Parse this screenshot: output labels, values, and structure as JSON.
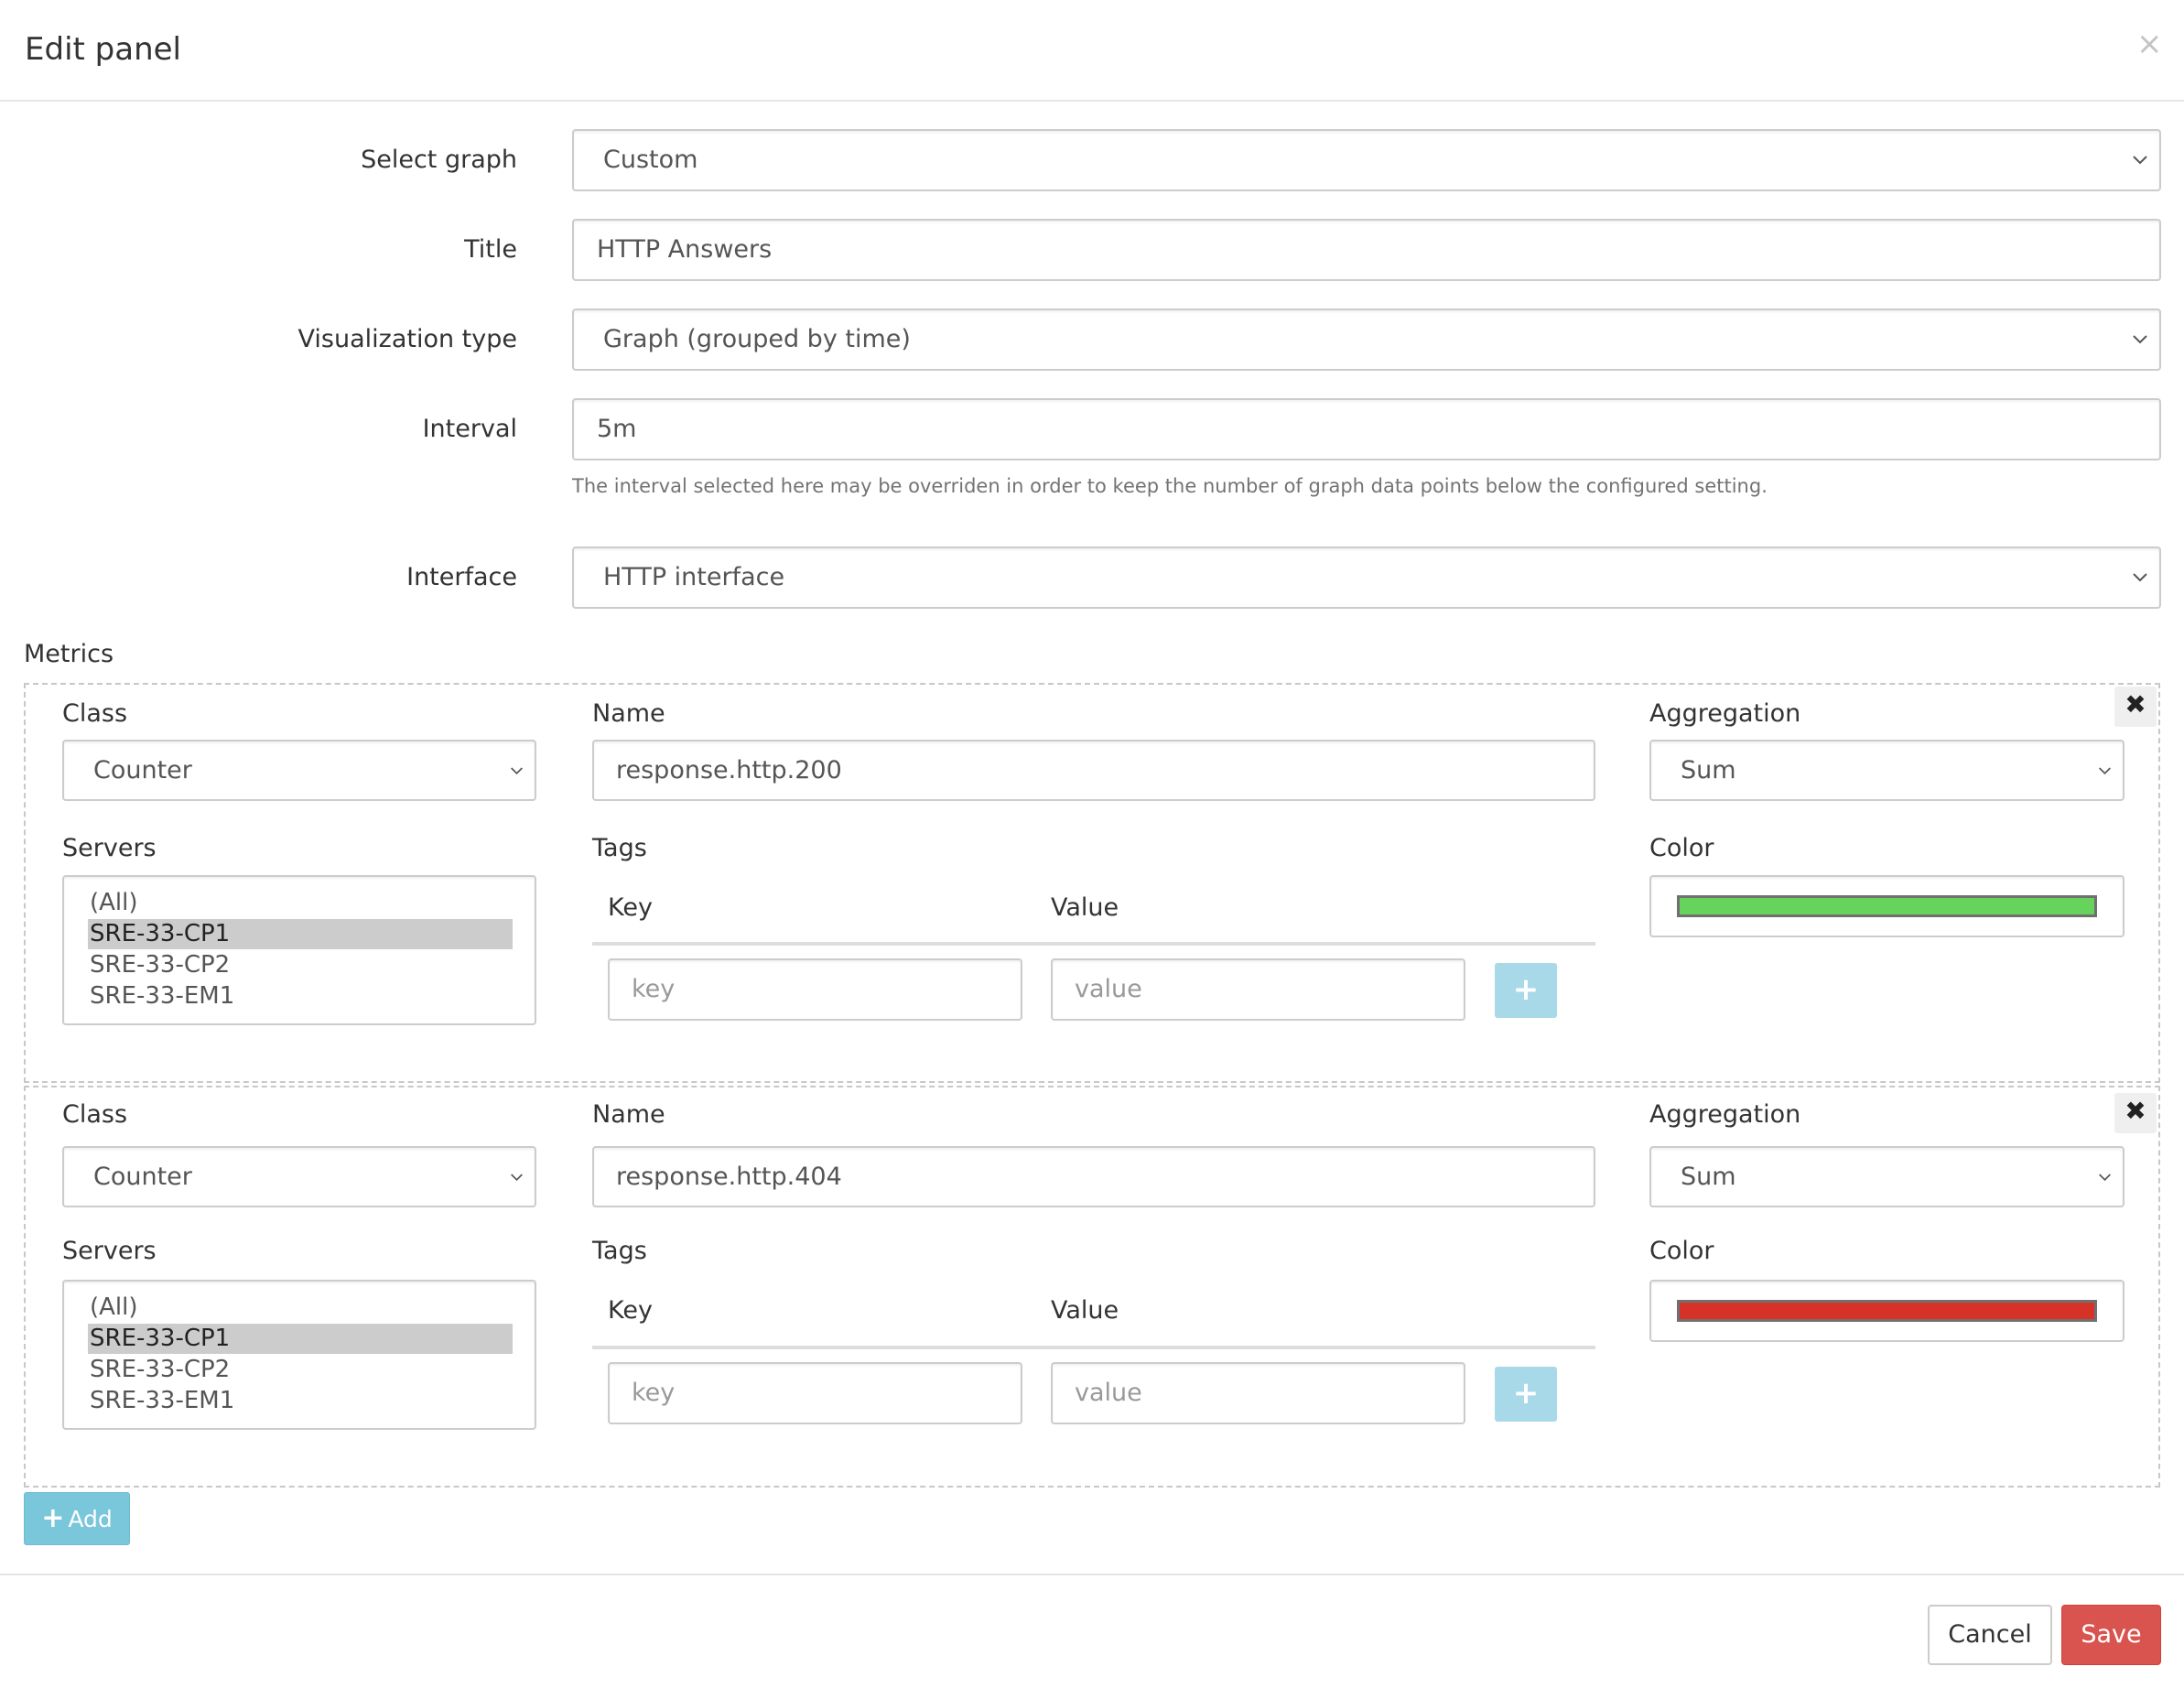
{
  "modal": {
    "title": "Edit panel",
    "close_icon": "close-icon"
  },
  "form": {
    "select_graph": {
      "label": "Select graph",
      "value": "Custom"
    },
    "title": {
      "label": "Title",
      "value": "HTTP Answers"
    },
    "visualization_type": {
      "label": "Visualization type",
      "value": "Graph (grouped by time)"
    },
    "interval": {
      "label": "Interval",
      "value": "5m",
      "help": "The interval selected here may be overriden in order to keep the number of graph data points below the configured setting."
    },
    "interface": {
      "label": "Interface",
      "value": "HTTP interface"
    }
  },
  "metrics": {
    "label": "Metrics",
    "field_labels": {
      "class": "Class",
      "name": "Name",
      "aggregation": "Aggregation",
      "servers": "Servers",
      "tags": "Tags",
      "key": "Key",
      "value": "Value",
      "color": "Color"
    },
    "tag_placeholders": {
      "key": "key",
      "value": "value"
    },
    "plus_label": "+",
    "remove_label": "✖",
    "items": [
      {
        "class": "Counter",
        "name": "response.http.200",
        "aggregation": "Sum",
        "servers": [
          "(All)",
          "SRE-33-CP1",
          "SRE-33-CP2",
          "SRE-33-EM1"
        ],
        "selected_server": "SRE-33-CP1",
        "color": "#66d45c"
      },
      {
        "class": "Counter",
        "name": "response.http.404",
        "aggregation": "Sum",
        "servers": [
          "(All)",
          "SRE-33-CP1",
          "SRE-33-CP2",
          "SRE-33-EM1"
        ],
        "selected_server": "SRE-33-CP1",
        "color": "#d63228"
      }
    ]
  },
  "buttons": {
    "add": "Add",
    "add_icon": "+",
    "cancel": "Cancel",
    "save": "Save"
  },
  "colors": {
    "save": "#d9534f",
    "add": "#7ac6da",
    "plus_disabled": "#a8d9e8"
  }
}
